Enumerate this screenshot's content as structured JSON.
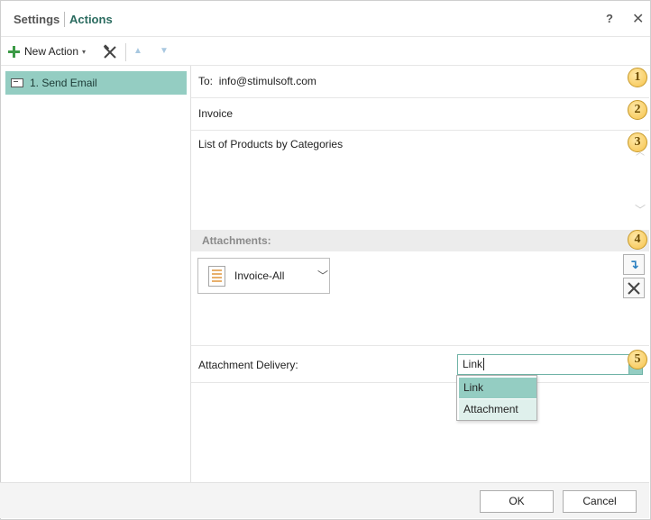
{
  "titlebar": {
    "settings_label": "Settings",
    "actions_label": "Actions",
    "help_label": "?",
    "close_label": "✕"
  },
  "toolbar": {
    "new_action_label": "New Action",
    "new_action_caret": "▾",
    "move_up_glyph": "▲",
    "move_down_glyph": "▼"
  },
  "actions_list": {
    "items": [
      {
        "label": "1. Send Email",
        "icon": "mail-icon",
        "selected": true
      }
    ]
  },
  "email": {
    "to_label": "To:",
    "to_value": "info@stimulsoft.com",
    "subject": "Invoice",
    "body": "List of Products by Categories"
  },
  "badges": [
    "1",
    "2",
    "3",
    "4",
    "5"
  ],
  "attachments": {
    "header": "Attachments:",
    "items": [
      {
        "label": "Invoice-All",
        "icon": "document-icon"
      }
    ],
    "add_glyph": "↴"
  },
  "delivery": {
    "label": "Attachment Delivery:",
    "value": "Link",
    "options": [
      "Link",
      "Attachment"
    ],
    "highlighted": "Link"
  },
  "footer": {
    "ok_label": "OK",
    "cancel_label": "Cancel"
  },
  "colors": {
    "accent": "#94cdc2",
    "title_accent": "#2a6b5f",
    "badge": "#f6c24a",
    "plus": "#3c9a46"
  }
}
